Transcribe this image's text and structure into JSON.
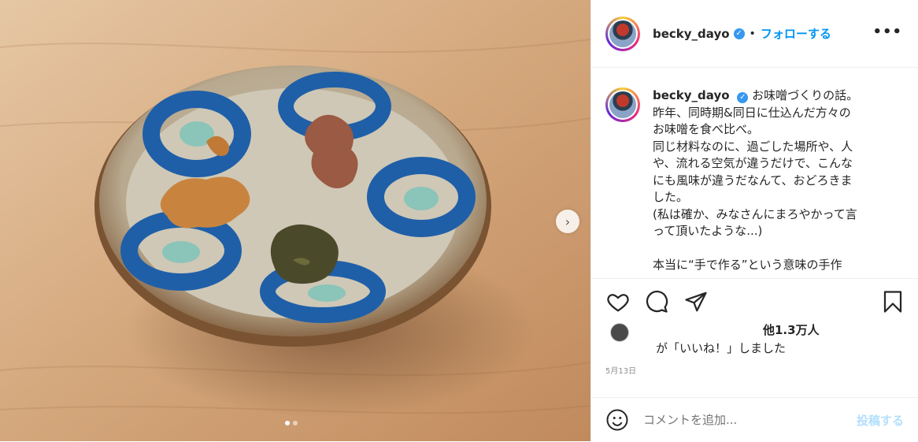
{
  "photo": {
    "description_icon": "miso-dish-photo",
    "carousel_dots": 2,
    "active_dot": 0
  },
  "header": {
    "username": "becky_dayo",
    "follow": "フォローする",
    "separator": "•",
    "more": "•••"
  },
  "caption": {
    "username": "becky_dayo",
    "lines": [
      "お味噌づくりの話。",
      "昨年、同時期&同日に仕込んだ方々の",
      "お味噌を食べ比べ。",
      "同じ材料なのに、過ごした場所や、人",
      "や、流れる空気が違うだけで、こんな",
      "にも風味が違うだなんて、おどろきま",
      "した。",
      "(私は確か、みなさんにまろやかって言",
      "って頂いたような...)",
      "",
      "本当に“手で作る”という意味の手作"
    ]
  },
  "likes": {
    "count": "他1.3万人",
    "text": "が「いいね！」しました"
  },
  "date": "5月13日",
  "comment": {
    "placeholder": "コメントを追加...",
    "post_label": "投稿する"
  },
  "colors": {
    "accent": "#0095f6",
    "verified": "#3897f0",
    "post_disabled": "#b2dffc"
  }
}
